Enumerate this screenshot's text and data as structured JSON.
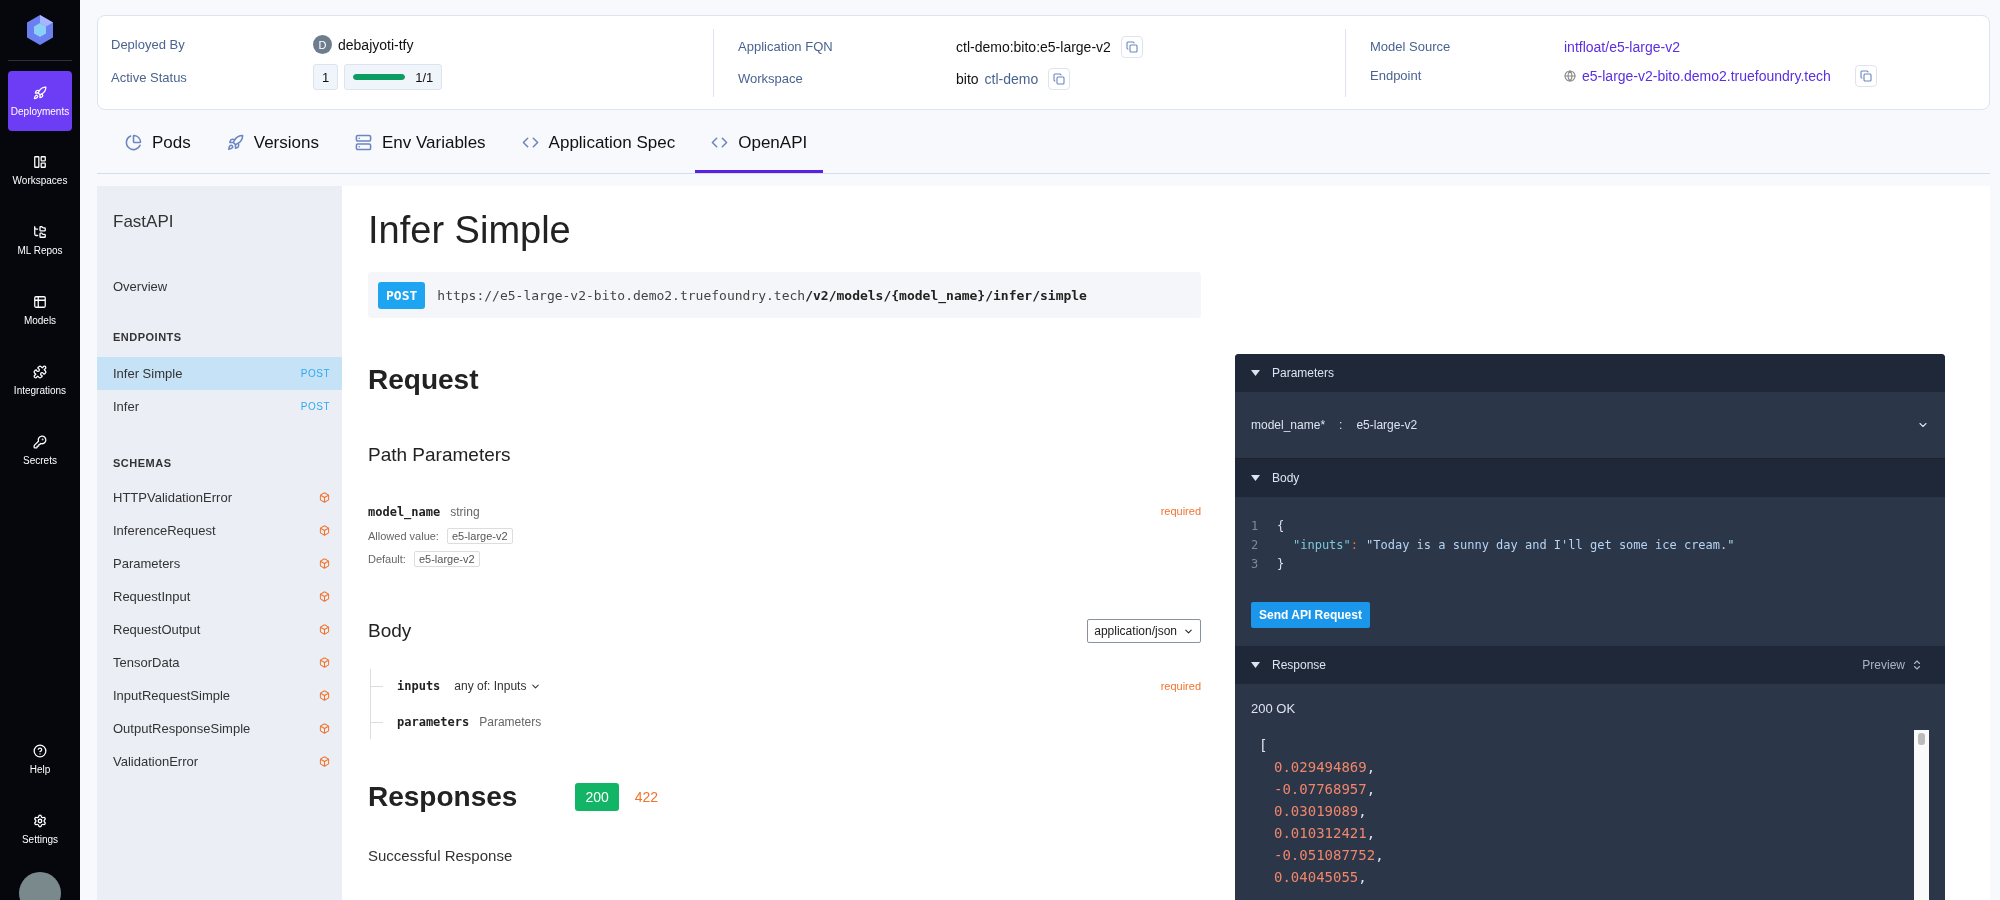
{
  "nav": {
    "items": [
      {
        "label": "Deployments",
        "selected": true
      },
      {
        "label": "Workspaces",
        "selected": false
      },
      {
        "label": "ML Repos",
        "selected": false
      },
      {
        "label": "Models",
        "selected": false
      },
      {
        "label": "Integrations",
        "selected": false
      },
      {
        "label": "Secrets",
        "selected": false
      }
    ],
    "bottom_items": [
      {
        "label": "Help"
      },
      {
        "label": "Settings"
      }
    ]
  },
  "header": {
    "deployed_by": {
      "label": "Deployed By",
      "avatar_letter": "D",
      "value": "debajyoti-tfy"
    },
    "active_status": {
      "label": "Active Status",
      "count": "1",
      "level": 1,
      "reading": "1/1"
    },
    "application_fqn": {
      "label": "Application FQN",
      "value": "ctl-demo:bito:e5-large-v2"
    },
    "workspace": {
      "label": "Workspace",
      "value": "bito",
      "link": "ctl-demo"
    },
    "model_source": {
      "label": "Model Source",
      "value": "intfloat/e5-large-v2"
    },
    "endpoint": {
      "label": "Endpoint",
      "value": "e5-large-v2-bito.demo2.truefoundry.tech"
    }
  },
  "tabs": [
    {
      "label": "Pods",
      "selected": false
    },
    {
      "label": "Versions",
      "selected": false
    },
    {
      "label": "Env Variables",
      "selected": false
    },
    {
      "label": "Application Spec",
      "selected": false
    },
    {
      "label": "OpenAPI",
      "selected": true
    }
  ],
  "doc_sidebar": {
    "title": "FastAPI",
    "overview": "Overview",
    "endpoints_heading": "ENDPOINTS",
    "endpoints": [
      {
        "label": "Infer Simple",
        "method": "POST",
        "selected": true
      },
      {
        "label": "Infer",
        "method": "POST",
        "selected": false
      }
    ],
    "schemas_heading": "SCHEMAS",
    "schemas": [
      "HTTPValidationError",
      "InferenceRequest",
      "Parameters",
      "RequestInput",
      "RequestOutput",
      "TensorData",
      "InputRequestSimple",
      "OutputResponseSimple",
      "ValidationError"
    ]
  },
  "operation": {
    "title": "Infer Simple",
    "method": "POST",
    "url": "https://e5-large-v2-bito.demo2.truefoundry.tech**/v2/models/{model_name}/infer/simple**",
    "request_heading": "Request",
    "path_parameters_heading": "Path Parameters",
    "path_parameters": [
      {
        "name": "model_name",
        "type": "string",
        "required": "required",
        "allowed_label": "Allowed value:",
        "allowed": "e5-large-v2",
        "default_label": "Default:",
        "default": "e5-large-v2"
      }
    ],
    "body_heading": "Body",
    "content_type": "application/json",
    "body_fields": [
      {
        "name": "inputs",
        "type": "any of: Inputs",
        "expandable": true,
        "required": "required"
      },
      {
        "name": "parameters",
        "type": "Parameters",
        "expandable": false
      }
    ],
    "responses_heading": "Responses",
    "response_codes": [
      {
        "label": "200",
        "selected": true
      },
      {
        "label": "422",
        "selected": false
      }
    ],
    "response_description": "Successful Response"
  },
  "console": {
    "parameters_header": "Parameters",
    "param_name": "model_name*",
    "param_separator": ":",
    "param_value": "e5-large-v2",
    "body_header": "Body",
    "code_lines": [
      {
        "number": "1",
        "tokens": [
          {
            "kind": "punct",
            "text": "{"
          }
        ]
      },
      {
        "number": "2",
        "tokens": [
          {
            "kind": "key",
            "text": "\"inputs\""
          },
          {
            "kind": "colon",
            "text": ":"
          },
          {
            "kind": "string",
            "text": "\"Today is a sunny day and I'll get some ice cream.\""
          }
        ]
      },
      {
        "number": "3",
        "tokens": [
          {
            "kind": "punct",
            "text": "}"
          }
        ]
      }
    ],
    "send_button": "Send API Request",
    "response_header": "Response",
    "preview": "Preview",
    "status": "200 OK",
    "response_lines": [
      {
        "tokens": [
          {
            "kind": "punct",
            "text": "["
          }
        ]
      },
      {
        "tokens": [
          {
            "kind": "number",
            "text": "0.029494869"
          },
          {
            "kind": "punct",
            "text": ","
          }
        ]
      },
      {
        "tokens": [
          {
            "kind": "number",
            "text": "-0.07768957"
          },
          {
            "kind": "punct",
            "text": ","
          }
        ]
      },
      {
        "tokens": [
          {
            "kind": "number",
            "text": "0.03019089"
          },
          {
            "kind": "punct",
            "text": ","
          }
        ]
      },
      {
        "tokens": [
          {
            "kind": "number",
            "text": "0.010312421"
          },
          {
            "kind": "punct",
            "text": ","
          }
        ]
      },
      {
        "tokens": [
          {
            "kind": "number",
            "text": "-0.051087752"
          },
          {
            "kind": "punct",
            "text": ","
          }
        ]
      },
      {
        "tokens": [
          {
            "kind": "number",
            "text": "0.04045055"
          },
          {
            "kind": "punct",
            "text": ","
          }
        ]
      }
    ]
  }
}
